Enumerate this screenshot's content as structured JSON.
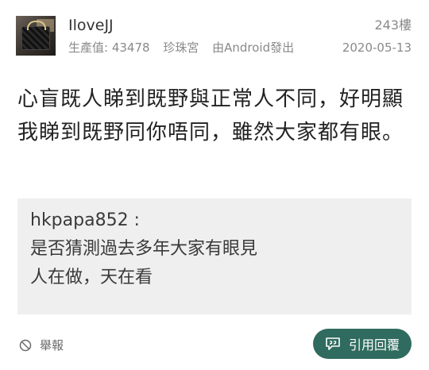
{
  "post": {
    "username": "IloveJJ",
    "floor": "243樓",
    "meta": {
      "production": "生產值: 43478",
      "rank": "珍珠宮",
      "platform": "由Android發出"
    },
    "date": "2020-05-13",
    "content": "心盲既人睇到既野與正常人不同，好明顯我睇到既野同你唔同，雖然大家都有眼。",
    "quote": {
      "author": "hkpapa852 :",
      "lines": [
        "是否猜測過去多年大家有眼見",
        "人在做，天在看"
      ]
    },
    "actions": {
      "report": "舉報",
      "reply": "引用回覆"
    }
  },
  "icons": {
    "report": "no-entry-icon",
    "reply": "quote-reply-icon"
  },
  "colors": {
    "accent": "#2f6b5e",
    "quote_bg": "#efefef",
    "muted_text": "#8a8a8a"
  }
}
